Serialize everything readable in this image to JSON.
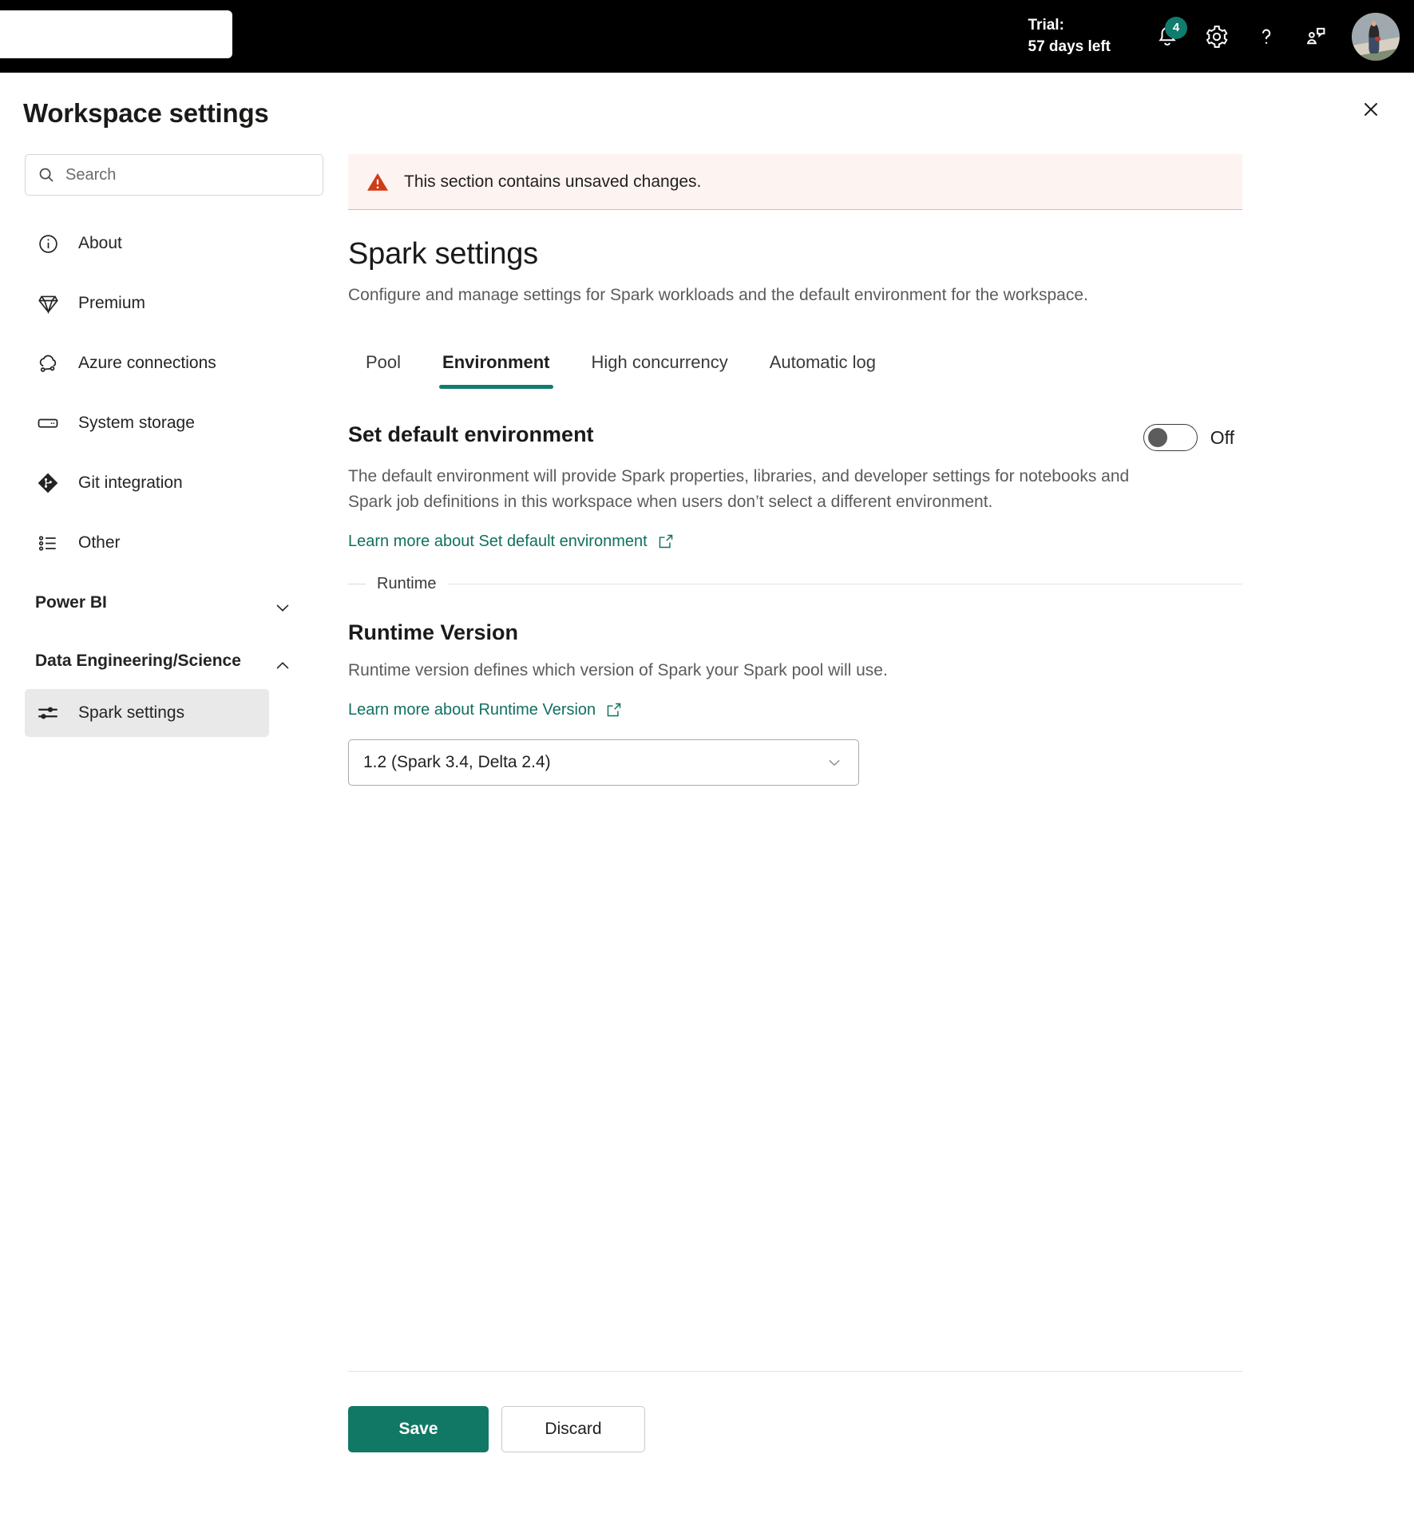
{
  "topbar": {
    "trial_label": "Trial:",
    "trial_days": "57 days left",
    "notification_badge": "4",
    "icons": {
      "notifications": "bell-icon",
      "settings": "gear-icon",
      "help": "question-mark-icon",
      "feedback": "feedback-icon",
      "account": "user-avatar"
    }
  },
  "panel": {
    "title": "Workspace settings",
    "close_label": "Close"
  },
  "sidebar": {
    "search": {
      "placeholder": "Search",
      "value": ""
    },
    "items": [
      {
        "label": "About",
        "icon": "info-circle-icon"
      },
      {
        "label": "Premium",
        "icon": "diamond-icon"
      },
      {
        "label": "Azure connections",
        "icon": "cloud-link-icon"
      },
      {
        "label": "System storage",
        "icon": "storage-icon"
      },
      {
        "label": "Git integration",
        "icon": "git-icon"
      },
      {
        "label": "Other",
        "icon": "list-icon"
      }
    ],
    "groups": [
      {
        "label": "Power BI",
        "expanded": false,
        "chevron": "chevron-down-icon",
        "children": []
      },
      {
        "label": "Data Engineering/Science",
        "expanded": true,
        "chevron": "chevron-up-icon",
        "children": [
          {
            "label": "Spark settings",
            "icon": "sliders-icon",
            "selected": true
          }
        ]
      }
    ]
  },
  "main": {
    "banner": {
      "icon": "warning-triangle-icon",
      "text": "This section contains unsaved changes."
    },
    "title": "Spark settings",
    "subtitle": "Configure and manage settings for Spark workloads and the default environment for the workspace.",
    "tabs": [
      {
        "label": "Pool",
        "active": false
      },
      {
        "label": "Environment",
        "active": true
      },
      {
        "label": "High concurrency",
        "active": false
      },
      {
        "label": "Automatic log",
        "active": false
      }
    ],
    "default_environment": {
      "heading": "Set default environment",
      "toggle_state": "Off",
      "toggle_on": false,
      "description": "The default environment will provide Spark properties, libraries, and developer settings for notebooks and Spark job definitions in this workspace when users don’t select a different environment.",
      "learn_more": "Learn more about Set default environment",
      "learn_more_icon": "open-in-new-icon"
    },
    "runtime_divider": "Runtime",
    "runtime": {
      "heading": "Runtime Version",
      "description": "Runtime version defines which version of Spark your Spark pool will use.",
      "learn_more": "Learn more about Runtime Version",
      "learn_more_icon": "open-in-new-icon",
      "select_value": "1.2 (Spark 3.4, Delta 2.4)",
      "select_chevron": "chevron-down-icon"
    },
    "footer": {
      "save_label": "Save",
      "discard_label": "Discard"
    }
  },
  "colors": {
    "accent": "#107c6e",
    "primary_button": "#117865",
    "warning_bg": "#fdf3f1",
    "warning_border": "#e5b4a6",
    "warning_icon": "#d03b17",
    "topbar_bg": "#000000",
    "selected_nav_bg": "#e9e9e9"
  }
}
